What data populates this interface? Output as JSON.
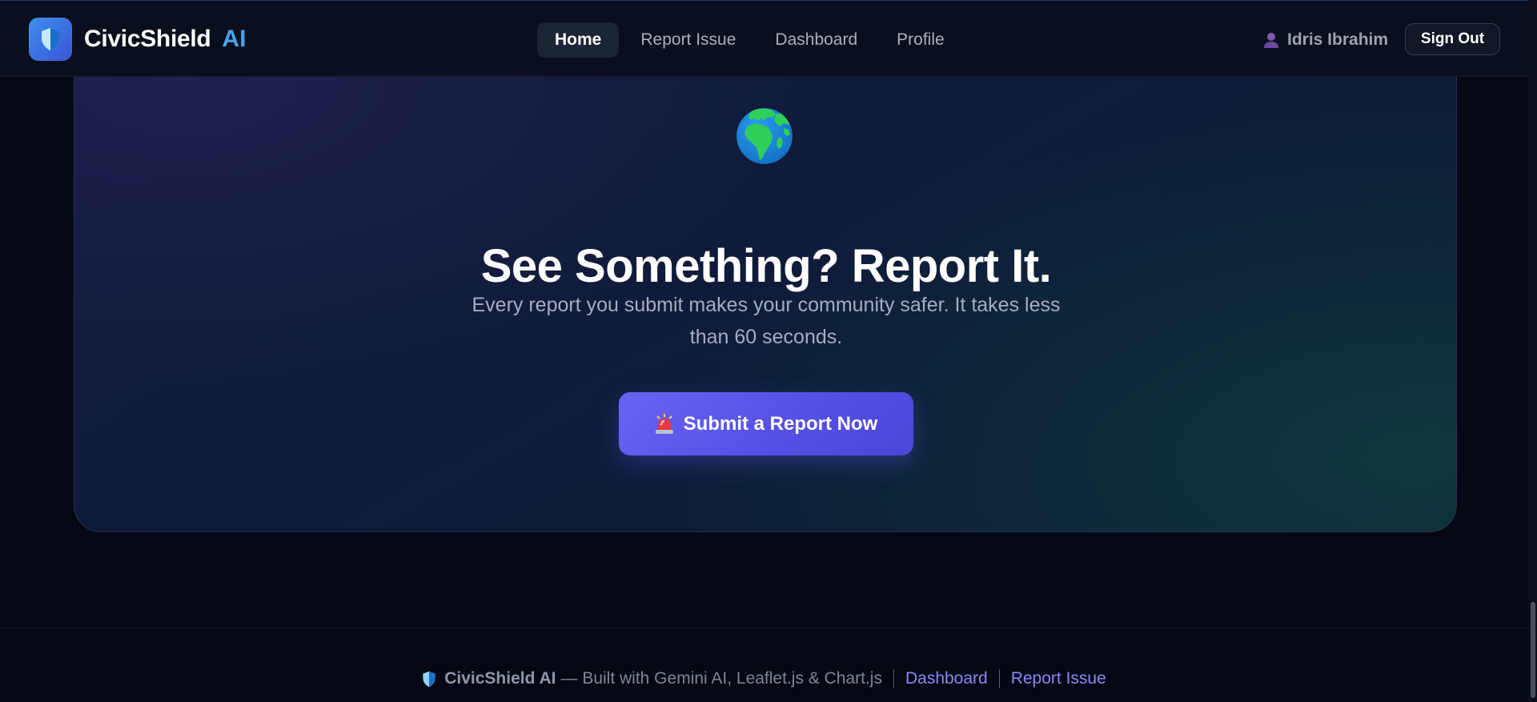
{
  "header": {
    "brand_name": "CivicShield",
    "brand_suffix": "AI",
    "nav": [
      {
        "label": "Home",
        "active": true
      },
      {
        "label": "Report Issue",
        "active": false
      },
      {
        "label": "Dashboard",
        "active": false
      },
      {
        "label": "Profile",
        "active": false
      }
    ],
    "user_name": "Idris Ibrahim",
    "sign_out_label": "Sign Out"
  },
  "hero": {
    "icon": "globe-europe-africa-icon",
    "title": "See Something? Report It.",
    "subtitle": "Every report you submit makes your community safer. It takes less than 60 seconds.",
    "cta_icon": "siren-icon",
    "cta_label": "Submit a Report Now"
  },
  "footer": {
    "brand": "CivicShield AI",
    "tagline": "— Built with Gemini AI, Leaflet.js & Chart.js",
    "links": [
      {
        "label": "Dashboard"
      },
      {
        "label": "Report Issue"
      }
    ]
  },
  "colors": {
    "page_background": "#050814",
    "header_background": "#0a0f1d",
    "brand_accent": "#4aa3ee",
    "cta_background": "#5750e6",
    "footer_link": "#8b87f5",
    "muted_text": "#a4adc2"
  }
}
